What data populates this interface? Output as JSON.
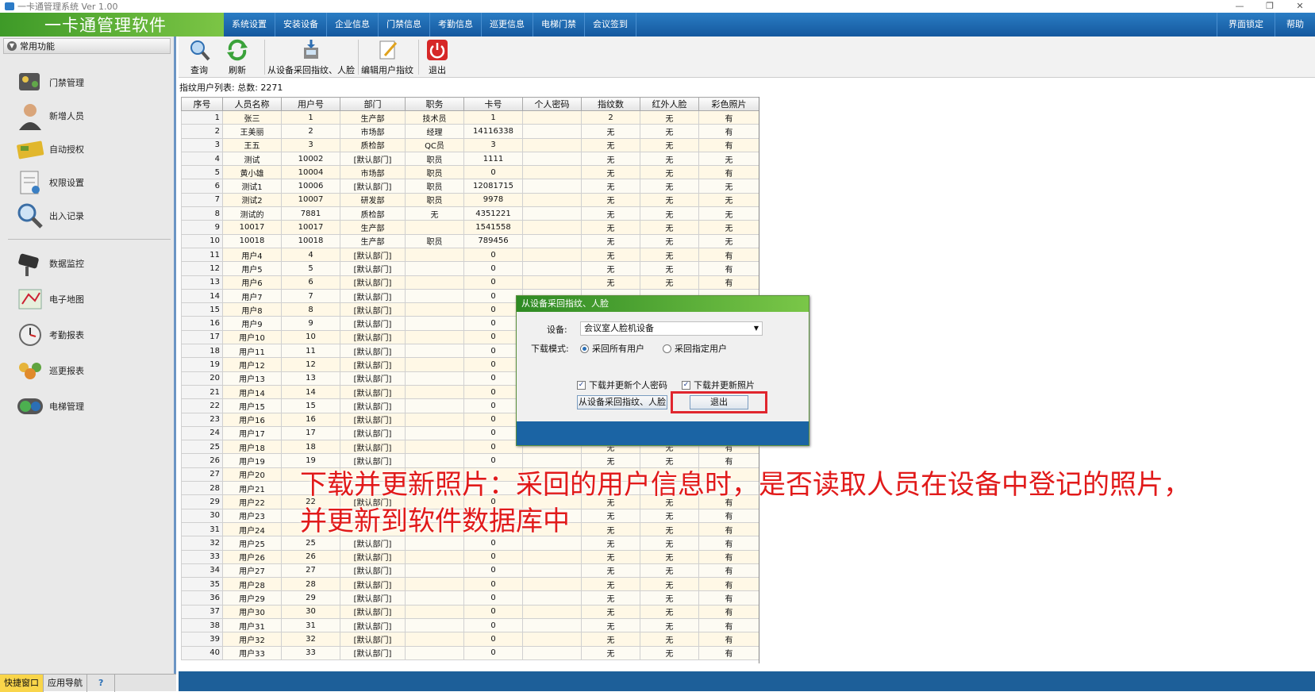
{
  "window": {
    "title": "一卡通管理系统  Ver 1.00",
    "controls": [
      "—",
      "❐",
      "✕"
    ]
  },
  "app": {
    "logo_text": "一卡通管理软件"
  },
  "menu": {
    "items": [
      "系统设置",
      "安装设备",
      "企业信息",
      "门禁信息",
      "考勤信息",
      "巡更信息",
      "电梯门禁",
      "会议签到"
    ],
    "right": [
      "界面锁定",
      "帮助"
    ]
  },
  "sidebar": {
    "header": "常用功能",
    "group1": [
      "门禁管理",
      "新增人员",
      "自动授权",
      "权限设置",
      "出入记录"
    ],
    "group2": [
      "数据监控",
      "电子地图",
      "考勤报表",
      "巡更报表",
      "电梯管理"
    ],
    "tabs": [
      "快捷窗口",
      "应用导航",
      "?"
    ]
  },
  "toolbar": {
    "query": "查询",
    "refresh": "刷新",
    "collect": "从设备采回指纹、人脸",
    "edit": "编辑用户指纹",
    "exit": "退出"
  },
  "list": {
    "label": "指纹用户列表: 总数: 2271"
  },
  "table": {
    "columns": [
      "序号",
      "人员名称",
      "用户号",
      "部门",
      "职务",
      "卡号",
      "个人密码",
      "指纹数",
      "红外人脸",
      "彩色照片"
    ],
    "rows": [
      [
        "1",
        "张三",
        "1",
        "生产部",
        "技术员",
        "1",
        "",
        "2",
        "无",
        "有"
      ],
      [
        "2",
        "王美丽",
        "2",
        "市场部",
        "经理",
        "14116338",
        "",
        "无",
        "无",
        "有"
      ],
      [
        "3",
        "王五",
        "3",
        "质检部",
        "QC员",
        "3",
        "",
        "无",
        "无",
        "有"
      ],
      [
        "4",
        "测试",
        "10002",
        "[默认部门]",
        "职员",
        "1111",
        "",
        "无",
        "无",
        "无"
      ],
      [
        "5",
        "黄小雄",
        "10004",
        "市场部",
        "职员",
        "0",
        "",
        "无",
        "无",
        "有"
      ],
      [
        "6",
        "测试1",
        "10006",
        "[默认部门]",
        "职员",
        "12081715",
        "",
        "无",
        "无",
        "无"
      ],
      [
        "7",
        "测试2",
        "10007",
        "研发部",
        "职员",
        "9978",
        "",
        "无",
        "无",
        "无"
      ],
      [
        "8",
        "测试的",
        "7881",
        "质检部",
        "无",
        "4351221",
        "",
        "无",
        "无",
        "无"
      ],
      [
        "9",
        "10017",
        "10017",
        "生产部",
        "",
        "1541558",
        "",
        "无",
        "无",
        "无"
      ],
      [
        "10",
        "10018",
        "10018",
        "生产部",
        "职员",
        "789456",
        "",
        "无",
        "无",
        "无"
      ],
      [
        "11",
        "用户4",
        "4",
        "[默认部门]",
        "",
        "0",
        "",
        "无",
        "无",
        "有"
      ],
      [
        "12",
        "用户5",
        "5",
        "[默认部门]",
        "",
        "0",
        "",
        "无",
        "无",
        "有"
      ],
      [
        "13",
        "用户6",
        "6",
        "[默认部门]",
        "",
        "0",
        "",
        "无",
        "无",
        "有"
      ],
      [
        "14",
        "用户7",
        "7",
        "[默认部门]",
        "",
        "0",
        "",
        "",
        "",
        ""
      ],
      [
        "15",
        "用户8",
        "8",
        "[默认部门]",
        "",
        "0",
        "",
        "",
        "",
        ""
      ],
      [
        "16",
        "用户9",
        "9",
        "[默认部门]",
        "",
        "0",
        "",
        "",
        "",
        ""
      ],
      [
        "17",
        "用户10",
        "10",
        "[默认部门]",
        "",
        "0",
        "",
        "",
        "",
        ""
      ],
      [
        "18",
        "用户11",
        "11",
        "[默认部门]",
        "",
        "0",
        "",
        "",
        "",
        ""
      ],
      [
        "19",
        "用户12",
        "12",
        "[默认部门]",
        "",
        "0",
        "",
        "",
        "",
        ""
      ],
      [
        "20",
        "用户13",
        "13",
        "[默认部门]",
        "",
        "0",
        "",
        "",
        "",
        ""
      ],
      [
        "21",
        "用户14",
        "14",
        "[默认部门]",
        "",
        "0",
        "",
        "",
        "",
        ""
      ],
      [
        "22",
        "用户15",
        "15",
        "[默认部门]",
        "",
        "0",
        "",
        "",
        "",
        ""
      ],
      [
        "23",
        "用户16",
        "16",
        "[默认部门]",
        "",
        "0",
        "",
        "",
        "",
        ""
      ],
      [
        "24",
        "用户17",
        "17",
        "[默认部门]",
        "",
        "0",
        "",
        "",
        "",
        ""
      ],
      [
        "25",
        "用户18",
        "18",
        "[默认部门]",
        "",
        "0",
        "",
        "无",
        "无",
        "有"
      ],
      [
        "26",
        "用户19",
        "19",
        "[默认部门]",
        "",
        "0",
        "",
        "无",
        "无",
        "有"
      ],
      [
        "27",
        "用户20",
        "",
        "",
        "",
        "",
        "",
        "",
        "",
        ""
      ],
      [
        "28",
        "用户21",
        "",
        "",
        "",
        "",
        "",
        "",
        "",
        ""
      ],
      [
        "29",
        "用户22",
        "22",
        "[默认部门]",
        "",
        "0",
        "",
        "无",
        "无",
        "有"
      ],
      [
        "30",
        "用户23",
        "",
        "",
        "",
        "",
        "",
        "无",
        "无",
        "有"
      ],
      [
        "31",
        "用户24",
        "",
        "",
        "",
        "",
        "",
        "无",
        "无",
        "有"
      ],
      [
        "32",
        "用户25",
        "25",
        "[默认部门]",
        "",
        "0",
        "",
        "无",
        "无",
        "有"
      ],
      [
        "33",
        "用户26",
        "26",
        "[默认部门]",
        "",
        "0",
        "",
        "无",
        "无",
        "有"
      ],
      [
        "34",
        "用户27",
        "27",
        "[默认部门]",
        "",
        "0",
        "",
        "无",
        "无",
        "有"
      ],
      [
        "35",
        "用户28",
        "28",
        "[默认部门]",
        "",
        "0",
        "",
        "无",
        "无",
        "有"
      ],
      [
        "36",
        "用户29",
        "29",
        "[默认部门]",
        "",
        "0",
        "",
        "无",
        "无",
        "有"
      ],
      [
        "37",
        "用户30",
        "30",
        "[默认部门]",
        "",
        "0",
        "",
        "无",
        "无",
        "有"
      ],
      [
        "38",
        "用户31",
        "31",
        "[默认部门]",
        "",
        "0",
        "",
        "无",
        "无",
        "有"
      ],
      [
        "39",
        "用户32",
        "32",
        "[默认部门]",
        "",
        "0",
        "",
        "无",
        "无",
        "有"
      ],
      [
        "40",
        "用户33",
        "33",
        "[默认部门]",
        "",
        "0",
        "",
        "无",
        "无",
        "有"
      ]
    ]
  },
  "dialog": {
    "title": "从设备采回指纹、人脸",
    "device_label": "设备:",
    "device_value": "会议室人脸机设备",
    "mode_label": "下载模式:",
    "mode_all": "采回所有用户",
    "mode_specific": "采回指定用户",
    "chk_password": "下载并更新个人密码",
    "chk_photo": "下载并更新照片",
    "btn_collect": "从设备采回指纹、人脸",
    "btn_exit": "退出"
  },
  "caption": {
    "line1": "下载并更新照片：采回的用户信息时，是否读取人员在设备中登记的照片，",
    "line2": "并更新到软件数据库中"
  }
}
